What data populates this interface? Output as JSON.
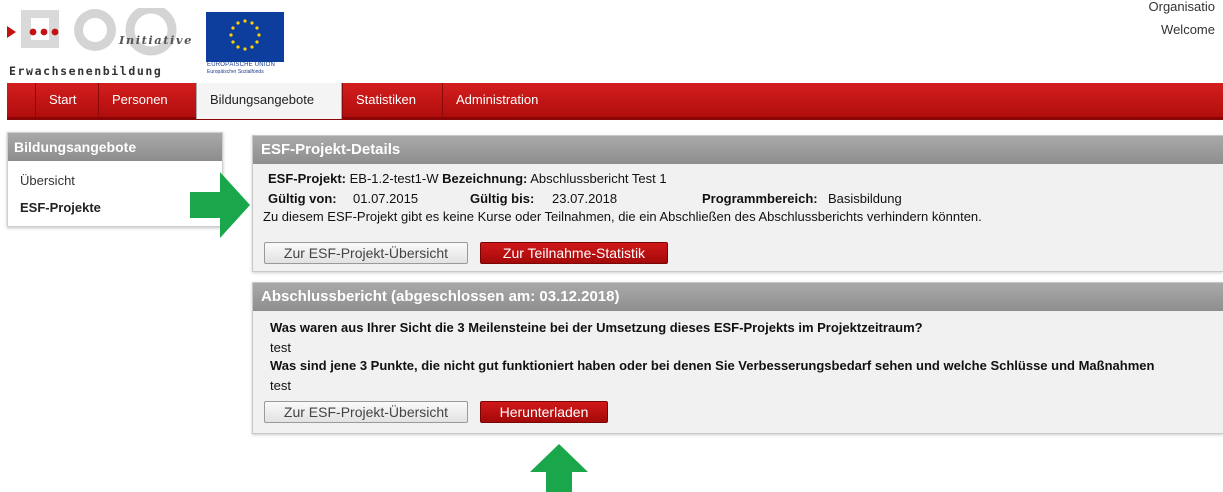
{
  "header": {
    "logo_text": "Erwachsenenbildung",
    "logo_tagline": "Initiative",
    "eu_line1": "EUROPÄISCHE UNION",
    "eu_line2": "Europäischer Sozialfonds",
    "top_right_line1": "Organisatio",
    "top_right_line2": "Welcome"
  },
  "nav": {
    "tabs": [
      {
        "label": "Start"
      },
      {
        "label": "Personen"
      },
      {
        "label": "Bildungsangebote"
      },
      {
        "label": "Statistiken"
      },
      {
        "label": "Administration"
      }
    ],
    "active": "Bildungsangebote"
  },
  "sidebar": {
    "title": "Bildungsangebote",
    "items": [
      {
        "label": "Übersicht"
      },
      {
        "label": "ESF-Projekte"
      }
    ]
  },
  "details": {
    "title": "ESF-Projekt-Details",
    "projekt_label": "ESF-Projekt:",
    "projekt_value": "EB-1.2-test1-W",
    "bezeichnung_label": "Bezeichnung:",
    "bezeichnung_value": "Abschlussbericht Test 1",
    "gueltig_von_label": "Gültig von:",
    "gueltig_von_value": "01.07.2015",
    "gueltig_bis_label": "Gültig bis:",
    "gueltig_bis_value": "23.07.2018",
    "programmbereich_label": "Programmbereich:",
    "programmbereich_value": "Basisbildung",
    "note": "Zu diesem ESF-Projekt gibt es keine Kurse oder Teilnahmen, die ein Abschließen des Abschlussberichts verhindern könnten.",
    "btn_overview": "Zur ESF-Projekt-Übersicht",
    "btn_statistik": "Zur Teilnahme-Statistik"
  },
  "report": {
    "title": "Abschlussbericht (abgeschlossen am: 03.12.2018)",
    "q1": "Was waren aus Ihrer Sicht die 3 Meilensteine bei der Umsetzung dieses ESF-Projekts im Projektzeitraum?",
    "a1": "test",
    "q2": "Was sind jene 3 Punkte, die nicht gut funktioniert haben oder bei denen Sie Verbesserungsbedarf sehen und welche Schlüsse und Maßnahmen",
    "a2": "test",
    "btn_overview": "Zur ESF-Projekt-Übersicht",
    "btn_download": "Herunterladen"
  },
  "colors": {
    "nav_red": "#c01414",
    "panel_header_grey": "#9c9c9c",
    "annotation_arrow_green": "#1aa64a"
  }
}
